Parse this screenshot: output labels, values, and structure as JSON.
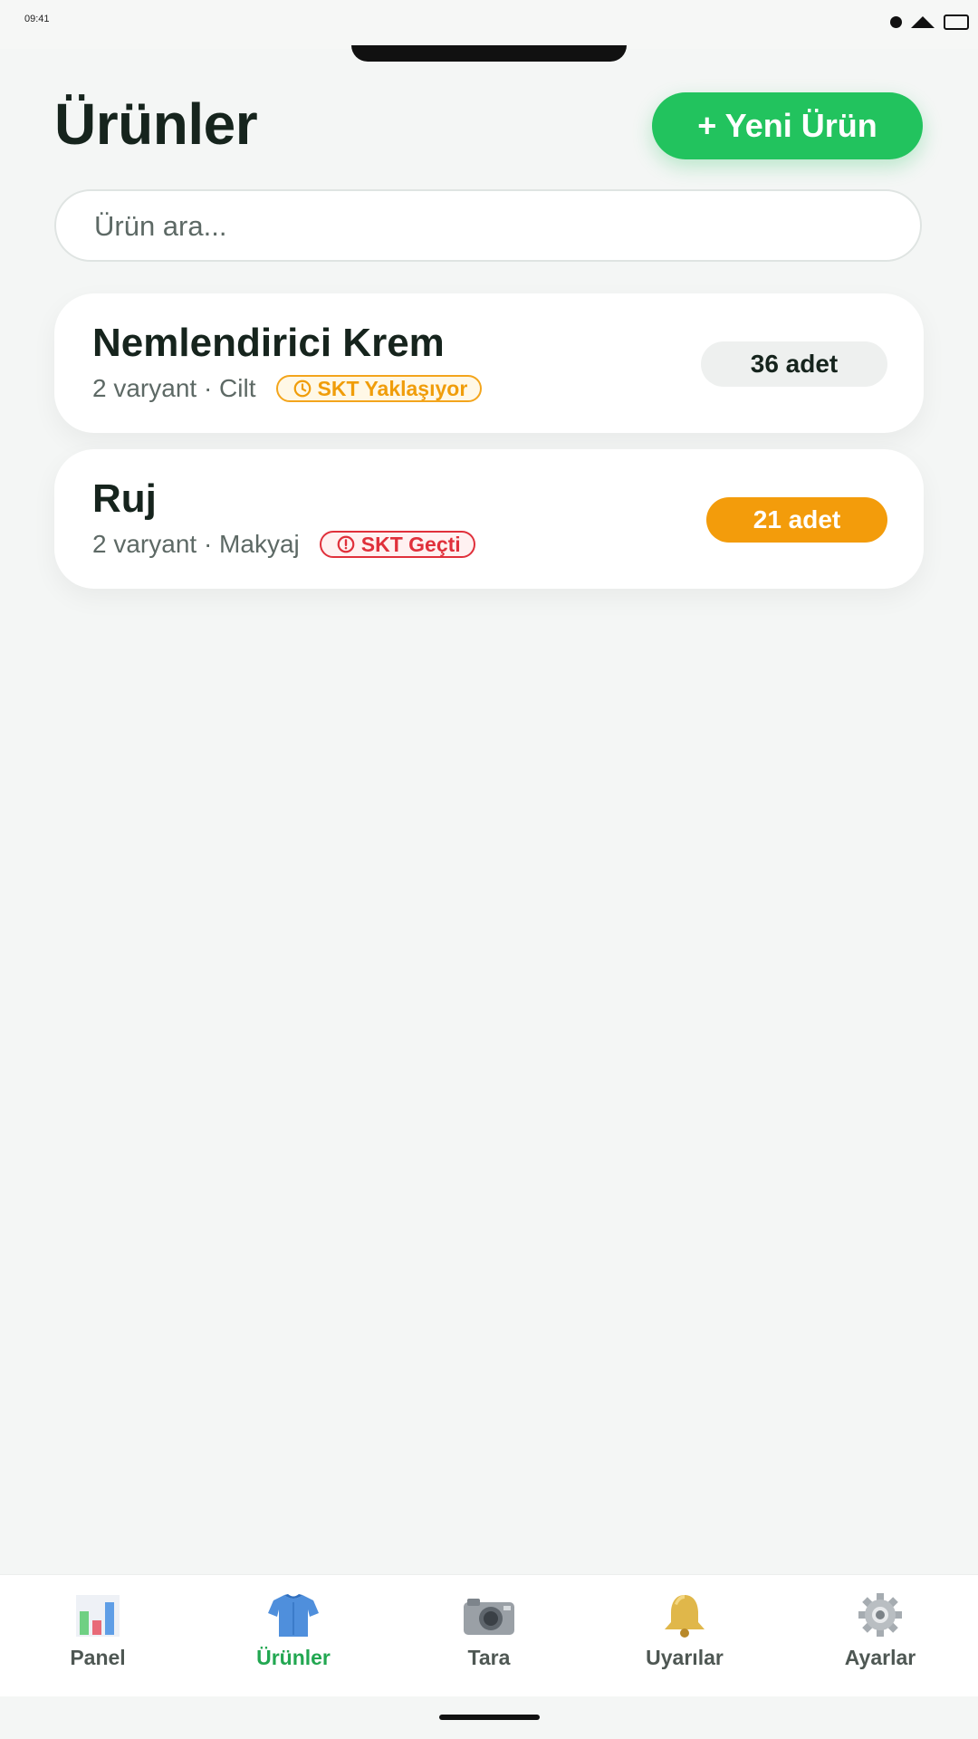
{
  "status": {
    "time": "09:41"
  },
  "header": {
    "title": "Ürünler",
    "new_button": "+ Yeni Ürün"
  },
  "search": {
    "placeholder": "Ürün ara...",
    "value": ""
  },
  "products": [
    {
      "name": "Nemlendirici Krem",
      "meta": "2 varyant · Cilt",
      "badge": "SKT Yaklaşıyor",
      "badge_status": "warning",
      "quantity": "36 adet",
      "quantity_status": "normal"
    },
    {
      "name": "Ruj",
      "meta": "2 varyant · Makyaj",
      "badge": "SKT Geçti",
      "badge_status": "danger",
      "quantity": "21 adet",
      "quantity_status": "warning"
    }
  ],
  "tabs": [
    {
      "label": "Panel",
      "icon": "chart-icon",
      "active": false
    },
    {
      "label": "Ürünler",
      "icon": "shirt-icon",
      "active": true
    },
    {
      "label": "Tara",
      "icon": "camera-icon",
      "active": false
    },
    {
      "label": "Uyarılar",
      "icon": "bell-icon",
      "active": false
    },
    {
      "label": "Ayarlar",
      "icon": "gear-icon",
      "active": false
    }
  ],
  "colors": {
    "accent": "#22c35e",
    "warning": "#f39c0b",
    "danger": "#e0303b",
    "active_tab": "#22a751"
  }
}
